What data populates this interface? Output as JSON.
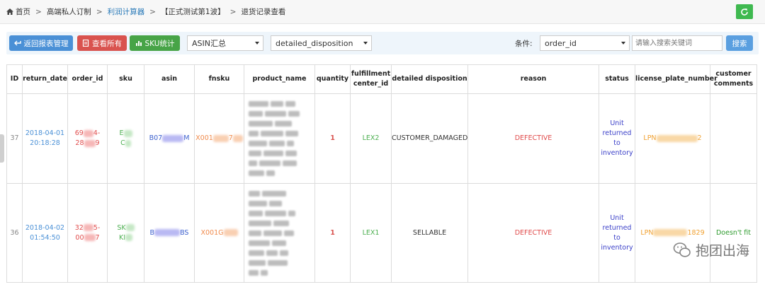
{
  "breadcrumb": {
    "items": [
      {
        "label": "首页"
      },
      {
        "label": "高端私人订制"
      },
      {
        "label": "利润计算器"
      },
      {
        "label": "【正式测试第1波】"
      },
      {
        "label": "退货记录查看"
      }
    ]
  },
  "toolbar": {
    "back_label": "返回报表管理",
    "view_all_label": "查看所有",
    "sku_stats_label": "SKU统计",
    "select_asin": "ASIN汇总",
    "select_disposition": "detailed_disposition",
    "condition_label": "条件:",
    "condition_select": "order_id",
    "search_placeholder": "请输入搜索关键词",
    "search_label": "搜索"
  },
  "table": {
    "headers": [
      "ID",
      "return_date",
      "order_id",
      "sku",
      "asin",
      "fnsku",
      "product_name",
      "quantity",
      "fulfillment center_id",
      "detailed disposition",
      "reason",
      "status",
      "license_plate_number",
      "customer comments"
    ],
    "rows": [
      {
        "id": "37",
        "date_line1": "2018-04-01",
        "date_line2": "20:18:28",
        "order_line1": "69",
        "order_line1b": "4-",
        "order_line2": "28",
        "order_line2b": "9",
        "sku_line1": "E",
        "sku_line2": "C",
        "asin_prefix": "B07",
        "asin_suffix": "M",
        "fnsku_prefix": "X001",
        "fnsku_suffix": "7",
        "quantity": "1",
        "center": "LEX2",
        "disposition": "CUSTOMER_DAMAGED",
        "reason": "DEFECTIVE",
        "status": "Unit returned to inventory",
        "lpn_prefix": "LPN",
        "lpn_suffix": "2",
        "comment": ""
      },
      {
        "id": "36",
        "date_line1": "2018-04-02",
        "date_line2": "01:54:50",
        "order_line1": "32",
        "order_line1b": "5-",
        "order_line2": "00",
        "order_line2b": "7",
        "sku_line1": "SK",
        "sku_line2": "KI",
        "asin_prefix": "B",
        "asin_suffix": "BS",
        "fnsku_prefix": "X001G",
        "fnsku_suffix": "",
        "quantity": "1",
        "center": "LEX1",
        "disposition": "SELLABLE",
        "reason": "DEFECTIVE",
        "status": "Unit returned to inventory",
        "lpn_prefix": "LPN",
        "lpn_suffix": "1829",
        "comment": "Doesn't fit"
      }
    ]
  },
  "watermark": {
    "text": "抱团出海"
  }
}
